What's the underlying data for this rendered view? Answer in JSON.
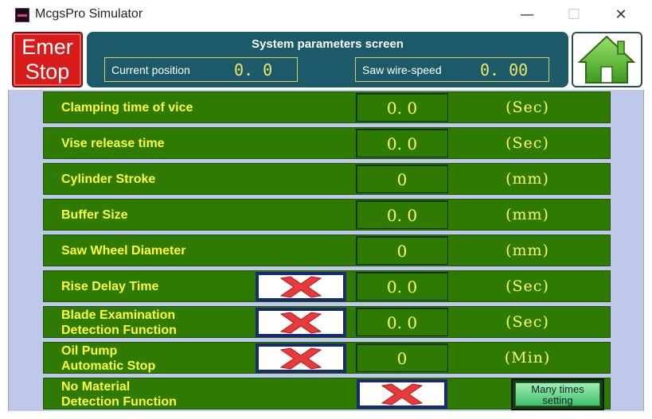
{
  "window": {
    "title": "McgsPro Simulator",
    "minimize_glyph": "—",
    "maximize_glyph": "☐",
    "close_glyph": "✕"
  },
  "header": {
    "emer_stop_line1": "Emer",
    "emer_stop_line2": "Stop",
    "title": "System parameters screen",
    "current_position_label": "Current position",
    "current_position_value": "0. 0",
    "saw_speed_label": "Saw wire-speed",
    "saw_speed_value": "0. 00",
    "home_icon": "home-icon"
  },
  "rows": [
    {
      "label": "Clamping time of vice",
      "value": "0. 0",
      "unit": "(Sec)"
    },
    {
      "label": "Vise release time",
      "value": "0. 0",
      "unit": "(Sec)"
    },
    {
      "label": "Cylinder Stroke",
      "value": "0",
      "unit": "(mm)"
    },
    {
      "label": "Buffer Size",
      "value": "0. 0",
      "unit": "(mm)"
    },
    {
      "label": "Saw Wheel Diameter",
      "value": "0",
      "unit": "(mm)"
    },
    {
      "label": "Rise Delay Time",
      "value": "0. 0",
      "unit": "(Sec)",
      "toggle": "off"
    },
    {
      "label_line1": "Blade Examination",
      "label_line2": "Detection Function",
      "value": "0. 0",
      "unit": "(Sec)",
      "toggle": "off"
    },
    {
      "label_line1": "Oil Pump",
      "label_line2": "Automatic Stop",
      "value": "0",
      "unit": "(Min)",
      "toggle": "off"
    },
    {
      "label_line1": "No Material",
      "label_line2": "Detection Function",
      "toggle": "off"
    }
  ],
  "many_times_button": {
    "line1": "Many times",
    "line2": "setting"
  },
  "colors": {
    "row_bg": "#2f7a00",
    "label_text": "#ffff33",
    "panel_bg": "#1c5a69",
    "emer_red": "#d81c1c",
    "client_bg": "#bdc8ea"
  }
}
